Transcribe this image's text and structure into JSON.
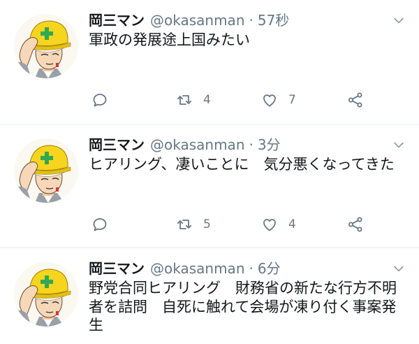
{
  "tweets": [
    {
      "author_name": "岡三マン",
      "handle": "@okasanman",
      "separator": "·",
      "time": "57秒",
      "text": "軍政の発展途上国みたい",
      "retweet_count": "4",
      "like_count": "7"
    },
    {
      "author_name": "岡三マン",
      "handle": "@okasanman",
      "separator": "·",
      "time": "3分",
      "text": "ヒアリング、凄いことに　気分悪くなってきた",
      "retweet_count": "5",
      "like_count": "4"
    },
    {
      "author_name": "岡三マン",
      "handle": "@okasanman",
      "separator": "·",
      "time": "6分",
      "text": "野党合同ヒアリング　財務省の新たな行方不明者を詰問　自死に触れて会場が凍り付く事案発生"
    }
  ],
  "icons": {
    "avatar": "helmet-character-avatar",
    "menu": "chevron-down-icon",
    "reply": "reply-icon",
    "retweet": "retweet-icon",
    "like": "heart-icon",
    "share": "share-icon"
  },
  "colors": {
    "background": "#ffffff",
    "text": "#14171a",
    "secondary": "#657786",
    "divider": "#e6ecf0",
    "helmet": "#f7d41e",
    "helmet_cross": "#32a852"
  }
}
